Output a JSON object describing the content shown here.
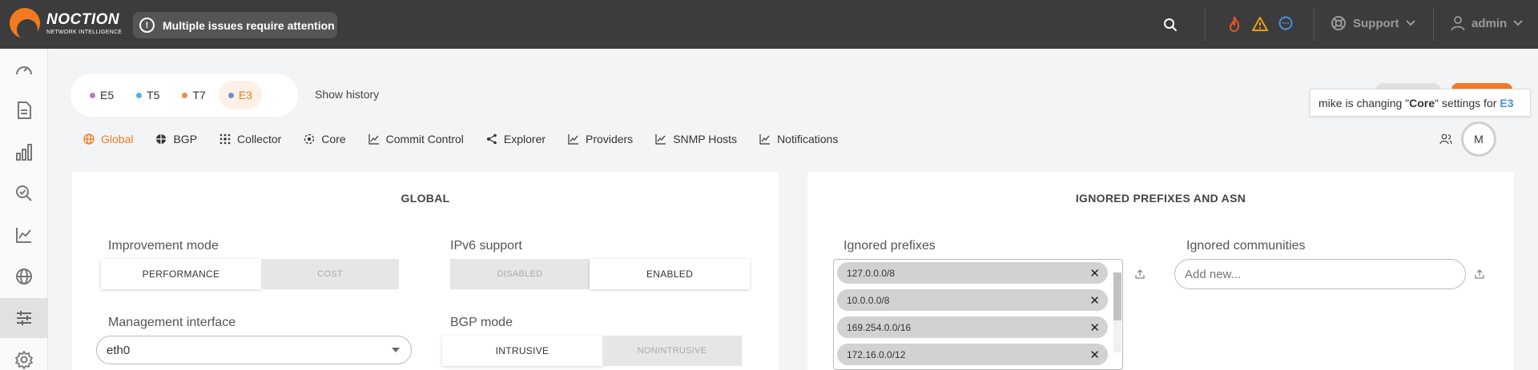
{
  "brand": {
    "name": "NOCTION",
    "tagline": "NETWORK INTELLIGENCE"
  },
  "topbar": {
    "alert": "Multiple issues require attention",
    "alert_icon": "exclamation-icon",
    "search_icon": "search-icon",
    "status_icons": [
      "fire-icon",
      "warning-icon",
      "chat-icon"
    ],
    "support_label": "Support",
    "user_label": "admin"
  },
  "colors": {
    "accent": "#f47a20",
    "topbar": "#3c3c3c",
    "fire": "#e8532a",
    "warning": "#f39c12",
    "chat": "#4a8fd6"
  },
  "sidebar": {
    "items": [
      {
        "icon": "speedometer-icon"
      },
      {
        "icon": "document-icon"
      },
      {
        "icon": "bar-chart-icon"
      },
      {
        "icon": "search-check-icon"
      },
      {
        "icon": "line-chart-icon"
      },
      {
        "icon": "globe-icon"
      },
      {
        "icon": "sliders-icon",
        "active": true
      },
      {
        "icon": "gear-icon"
      }
    ]
  },
  "servers": [
    {
      "label": "E5",
      "color": "#b07cc6"
    },
    {
      "label": "T5",
      "color": "#4fb3e8"
    },
    {
      "label": "T7",
      "color": "#f08a4b"
    },
    {
      "label": "E3",
      "color": "#6c8fd6",
      "active": true
    }
  ],
  "show_history": "Show history",
  "tooltip": {
    "user": "mike",
    "prefix": " is changing \"",
    "section": "Core",
    "suffix": "\" settings for",
    "server": "E3"
  },
  "nav": [
    {
      "label": "Global",
      "icon": "globe-icon",
      "active": true
    },
    {
      "label": "BGP",
      "icon": "bgp-icon"
    },
    {
      "label": "Collector",
      "icon": "collector-icon"
    },
    {
      "label": "Core",
      "icon": "core-icon"
    },
    {
      "label": "Commit Control",
      "icon": "chart-icon"
    },
    {
      "label": "Explorer",
      "icon": "share-icon"
    },
    {
      "label": "Providers",
      "icon": "chart-icon"
    },
    {
      "label": "SNMP Hosts",
      "icon": "chart-icon"
    },
    {
      "label": "Notifications",
      "icon": "chart-icon"
    }
  ],
  "avatar_initial": "M",
  "global_panel": {
    "title": "GLOBAL",
    "improvement_mode": {
      "label": "Improvement mode",
      "options": [
        "PERFORMANCE",
        "COST"
      ],
      "selected": "PERFORMANCE"
    },
    "ipv6": {
      "label": "IPv6 support",
      "options": [
        "DISABLED",
        "ENABLED"
      ],
      "selected": "ENABLED"
    },
    "mgmt_interface": {
      "label": "Management interface",
      "value": "eth0"
    },
    "bgp_mode": {
      "label": "BGP mode",
      "options": [
        "INTRUSIVE",
        "NONINTRUSIVE"
      ],
      "selected": "INTRUSIVE"
    }
  },
  "ignored_panel": {
    "title": "IGNORED PREFIXES AND ASN",
    "prefixes_label": "Ignored prefixes",
    "prefixes": [
      "127.0.0.0/8",
      "10.0.0.0/8",
      "169.254.0.0/16",
      "172.16.0.0/12"
    ],
    "communities_label": "Ignored communities",
    "communities_placeholder": "Add new..."
  }
}
